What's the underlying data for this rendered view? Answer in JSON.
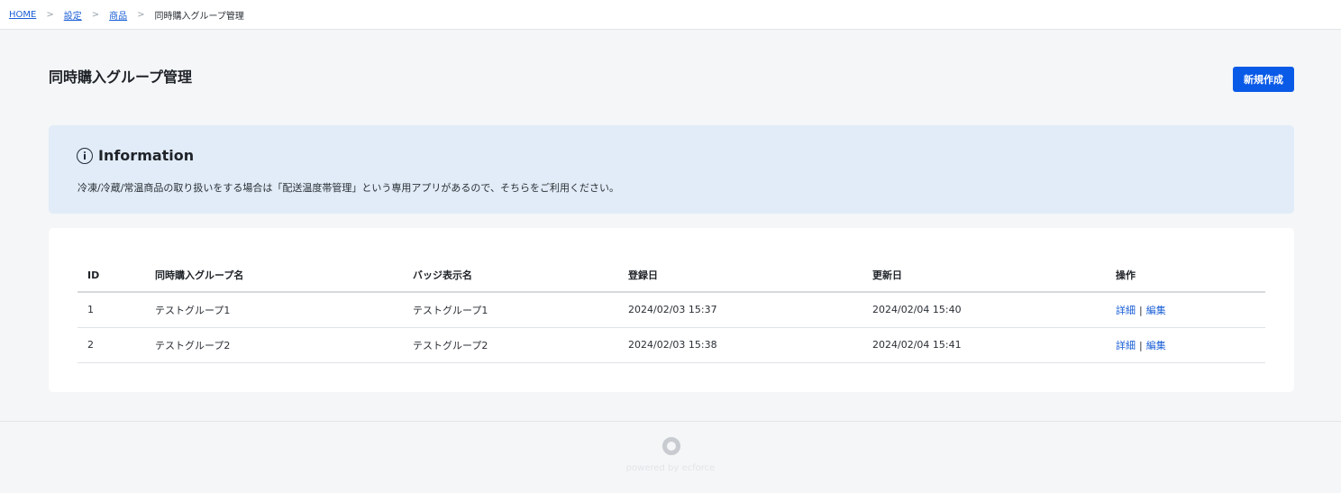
{
  "breadcrumb": {
    "items": [
      "HOME",
      "設定",
      "商品"
    ],
    "separator": ">",
    "current": "同時購入グループ管理"
  },
  "page": {
    "title": "同時購入グループ管理",
    "new_button": "新規作成"
  },
  "info": {
    "title": "Information",
    "text": "冷凍/冷蔵/常温商品の取り扱いをする場合は「配送温度帯管理」という専用アプリがあるので、そちらをご利用ください。"
  },
  "table": {
    "headers": [
      "ID",
      "同時購入グループ名",
      "バッジ表示名",
      "登録日",
      "更新日",
      "操作"
    ],
    "rows": [
      {
        "id": "1",
        "name": "テストグループ1",
        "badge": "テストグループ1",
        "created": "2024/02/03 15:37",
        "updated": "2024/02/04 15:40",
        "detail": "詳細",
        "sep": "|",
        "edit": "編集"
      },
      {
        "id": "2",
        "name": "テストグループ2",
        "badge": "テストグループ2",
        "created": "2024/02/03 15:38",
        "updated": "2024/02/04 15:41",
        "detail": "詳細",
        "sep": "|",
        "edit": "編集"
      }
    ]
  },
  "footer": {
    "text": "powered by ecforce"
  },
  "colors": {
    "accent": "#0a5ae8",
    "link": "#1a5fd6",
    "info_bg": "#e1ecf8"
  }
}
